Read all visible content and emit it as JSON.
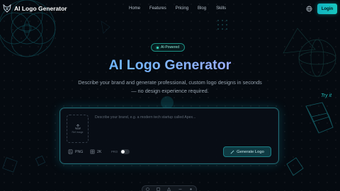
{
  "nav": {
    "brand": "AI Logo Generator",
    "links": [
      "Home",
      "Features",
      "Pricing",
      "Blog",
      "Skills"
    ],
    "login_label": "Login"
  },
  "hero": {
    "badge": "AI-Powered",
    "title": "AI Logo Generator",
    "subtitle": "Describe your brand and generate professional, custom logo designs in seconds — no design experience required.",
    "try_it": "Try it"
  },
  "card": {
    "upload_label": "Ref image",
    "prompt_placeholder": "Describe your brand, e.g. a modern tech startup called Apex...",
    "format_label": "PNG",
    "resolution_label": "2K",
    "pro_label": "PRO",
    "pro_enabled": false,
    "generate_label": "Generate Logo"
  },
  "colors": {
    "background": "#050a10",
    "accent": "#18c7bf",
    "title_gradient_start": "#4fb3ff",
    "title_gradient_end": "#c9a4ff"
  },
  "icons": {
    "brand": "fox-logo-icon",
    "language": "globe-icon",
    "upload": "upload-icon",
    "format": "image-file-icon",
    "resolution": "grid-icon",
    "generate": "wand-icon"
  }
}
